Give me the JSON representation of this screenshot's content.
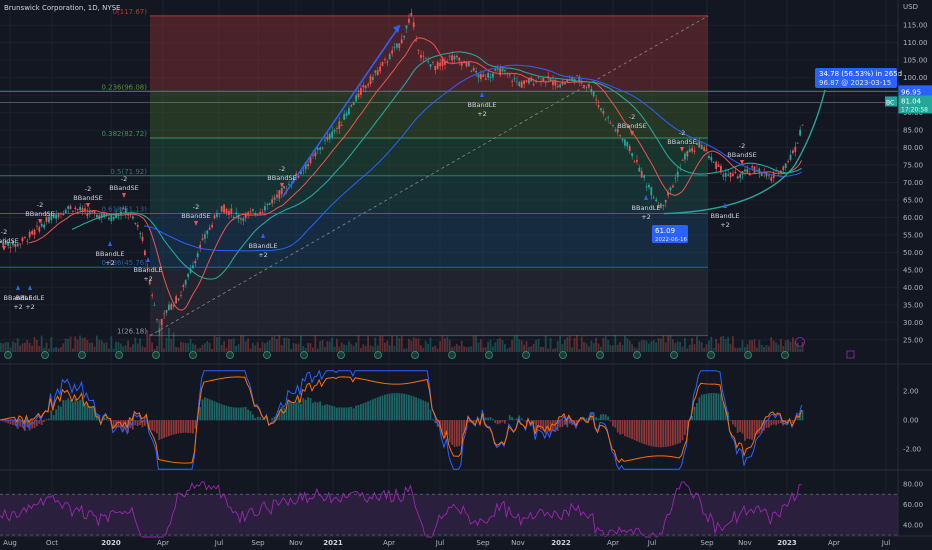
{
  "header": {
    "title": "Brunswick Corporation, 1D, NYSE"
  },
  "currency": "USD",
  "price_axis": [
    "115.00",
    "110.00",
    "105.00",
    "100.00",
    "95.00",
    "90.00",
    "85.00",
    "80.00",
    "75.00",
    "70.00",
    "65.00",
    "60.00",
    "55.00",
    "50.00",
    "45.00",
    "40.00",
    "35.00",
    "30.00",
    "25.00"
  ],
  "macd_axis": [
    "2.00",
    "0.00",
    "-2.00"
  ],
  "rsi_axis": [
    "80.00",
    "60.00",
    "40.00"
  ],
  "time_axis": [
    "Aug",
    "Oct",
    "2020",
    "Apr",
    "Jul",
    "Sep",
    "Nov",
    "2021",
    "Apr",
    "Jul",
    "Sep",
    "Nov",
    "2022",
    "Apr",
    "Jul",
    "Sep",
    "Nov",
    "2023",
    "Apr",
    "Jul"
  ],
  "fib_levels": [
    {
      "label": "0(117.67)",
      "value": 117.67,
      "color": "#b23a3a"
    },
    {
      "label": "0.236(96.08)",
      "value": 96.08,
      "color": "#5b8c3a"
    },
    {
      "label": "0.382(82.72)",
      "value": 82.72,
      "color": "#3f8f5a"
    },
    {
      "label": "0.5(71.92)",
      "value": 71.92,
      "color": "#2e7c6e"
    },
    {
      "label": "0.618(61.13)",
      "value": 61.13,
      "color": "#2a6a8c"
    },
    {
      "label": "0.786(45.76)",
      "value": 45.76,
      "color": "#2962a8"
    },
    {
      "label": "1(26.18)",
      "value": 26.18,
      "color": "#555"
    }
  ],
  "price_tags": {
    "p1": {
      "value": "96.95",
      "color": "#2962ff"
    },
    "p2": {
      "value": "81.04",
      "sub": "17:20:58",
      "color": "#26a69a"
    },
    "bc": "BC"
  },
  "annotations": {
    "gain_box": {
      "line1": "34.78 (56.53%) in 265d",
      "line2": "96.87 @ 2023-03-15"
    },
    "low_box": {
      "line1": "61.09",
      "line2": "2022-06-16"
    }
  },
  "signals": [
    {
      "text": "BBandSE",
      "tag": "-2"
    },
    {
      "text": "BBandLE",
      "tag": "+2"
    },
    {
      "text": "BBandSE",
      "tag": "-2"
    },
    {
      "text": "BBandLE",
      "tag": "+2"
    },
    {
      "text": "BBandSE",
      "tag": "-2"
    },
    {
      "text": "BBandLE",
      "tag": "+2"
    },
    {
      "text": "BBandSE",
      "tag": "-2"
    },
    {
      "text": "BBandLE",
      "tag": "+2"
    },
    {
      "text": "BBandSE",
      "tag": "-2"
    },
    {
      "text": "BBandLE",
      "tag": "+2"
    },
    {
      "text": "BBandSE",
      "tag": "-2"
    },
    {
      "text": "BBandLE",
      "tag": "+2"
    },
    {
      "text": "BBandSE",
      "tag": "-2"
    },
    {
      "text": "BBandLE",
      "tag": "+2"
    },
    {
      "text": "BBandSE",
      "tag": "-2"
    },
    {
      "text": "BBandLE",
      "tag": "+2"
    },
    {
      "text": "BBandSE",
      "tag": "-2"
    }
  ],
  "colors": {
    "bg": "#131722",
    "up": "#26a69a",
    "down": "#ef5350",
    "grid": "#1e222d",
    "rsi_band": "#2a1f3d",
    "rsi_line": "#9c27b0",
    "macd": "#2962ff",
    "signal": "#ff6d00"
  }
}
